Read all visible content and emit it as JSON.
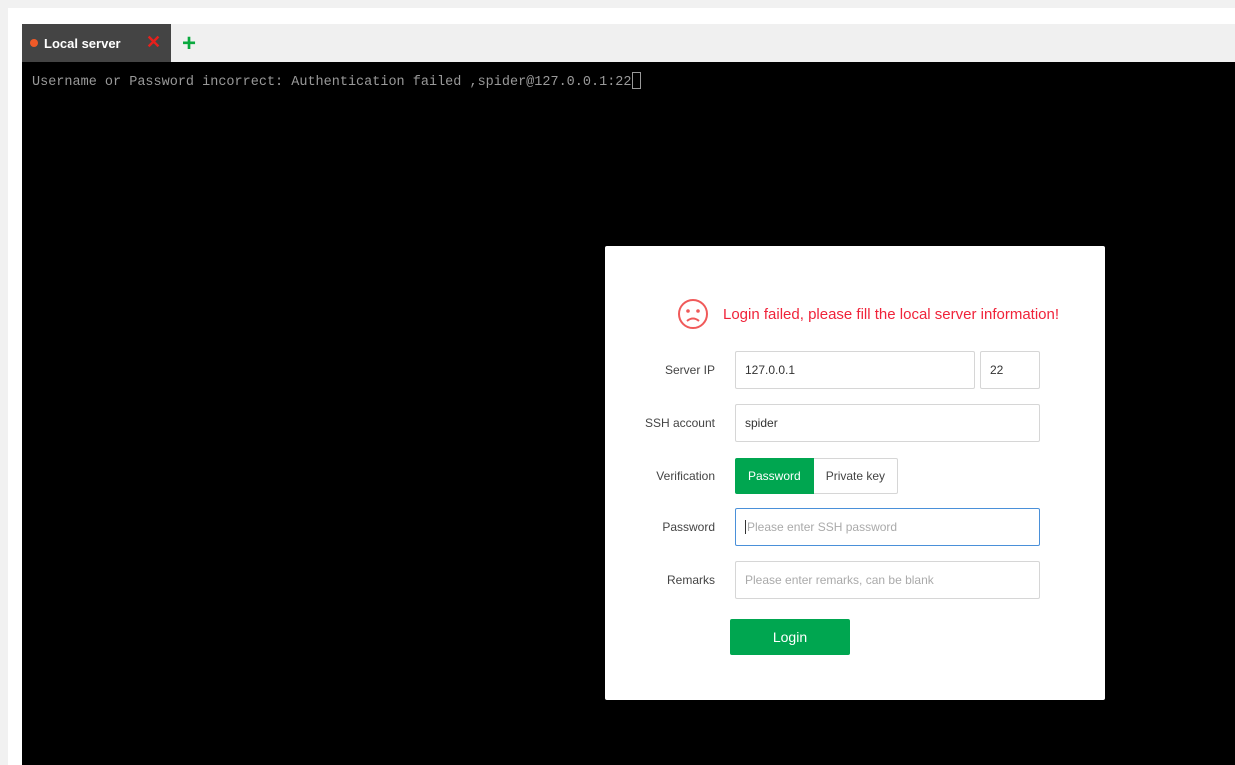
{
  "tabs": [
    {
      "label": "Local server",
      "status_color": "#f05a28"
    }
  ],
  "tab_close_icon": "✕",
  "add_tab_icon": "+",
  "terminal": {
    "line": "Username or Password incorrect: Authentication failed ,spider@127.0.0.1:22"
  },
  "dialog": {
    "error_message": "Login failed, please fill the local server information!",
    "server_ip": {
      "label": "Server IP",
      "value": "127.0.0.1",
      "port": "22"
    },
    "ssh_account": {
      "label": "SSH account",
      "value": "spider"
    },
    "verification": {
      "label": "Verification",
      "options": [
        "Password",
        "Private key"
      ],
      "selected": "Password"
    },
    "password": {
      "label": "Password",
      "placeholder": "Please enter SSH password"
    },
    "remarks": {
      "label": "Remarks",
      "placeholder": "Please enter remarks, can be blank"
    },
    "login_label": "Login"
  },
  "colors": {
    "accent": "#00a650",
    "error": "#f0233a"
  }
}
